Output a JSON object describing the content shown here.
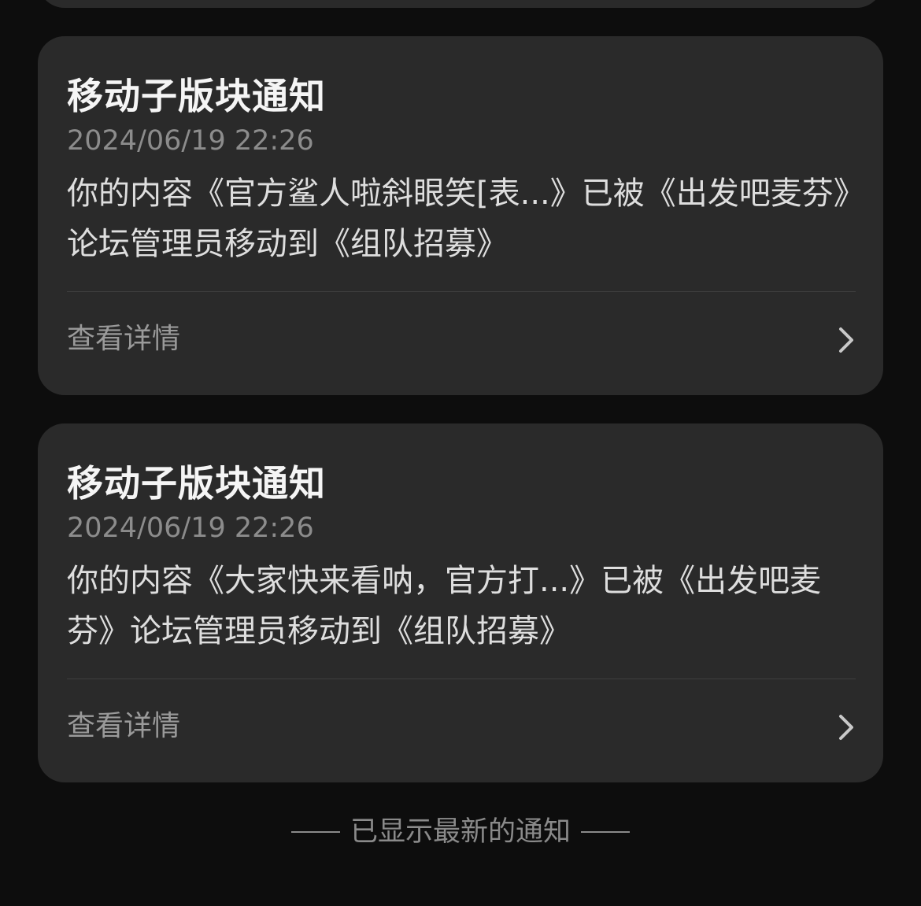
{
  "notifications": [
    {
      "title": "移动子版块通知",
      "time": "2024/06/19 22:26",
      "body": "你的内容《官方鲨人啦斜眼笑[表...》已被《出发吧麦芬》论坛管理员移动到《组队招募》",
      "action_label": "查看详情",
      "action_icon": "chevron-right-icon"
    },
    {
      "title": "移动子版块通知",
      "time": "2024/06/19 22:26",
      "body": "你的内容《大家快来看呐，官方打...》已被《出发吧麦芬》论坛管理员移动到《组队招募》",
      "action_label": "查看详情",
      "action_icon": "chevron-right-icon"
    }
  ],
  "footer": {
    "end_text": "已显示最新的通知"
  },
  "colors": {
    "background": "#0d0d0d",
    "card": "#2a2a2a",
    "title": "#f5f5f5",
    "secondary_text": "#8c8c8c"
  }
}
